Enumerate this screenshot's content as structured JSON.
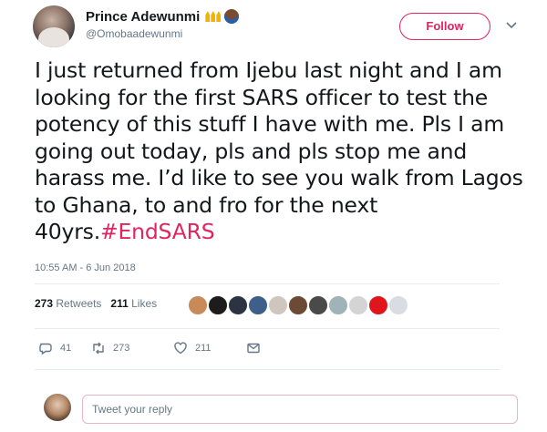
{
  "user": {
    "name": "Prince Adewunmi",
    "handle": "@Omobaadewunmi"
  },
  "follow_button": "Follow",
  "tweet": {
    "text": "I just returned from Ijebu last night and I am looking for the first SARS officer to test the potency of this stuff I have with me. Pls I am going out today, pls and pls stop me and harass me. I’d like to see you walk from Lagos to Ghana, to and fro for the next 40yrs.",
    "hashtag": "#EndSARS",
    "timestamp": "10:55 AM - 6 Jun 2018"
  },
  "stats": {
    "retweets_count": "273",
    "retweets_label": "Retweets",
    "likes_count": "211",
    "likes_label": "Likes"
  },
  "actions": {
    "replies": "41",
    "retweets": "273",
    "likes": "211"
  },
  "reply": {
    "placeholder": "Tweet your reply"
  },
  "colors": {
    "accent": "#e0245e",
    "muted": "#657786",
    "text": "#14171a",
    "divider": "#e6ecf0"
  },
  "icons": [
    "crown-emoji-icon",
    "face-emoji-icon",
    "chevron-down-icon",
    "reply-icon",
    "retweet-icon",
    "heart-icon",
    "message-icon"
  ]
}
